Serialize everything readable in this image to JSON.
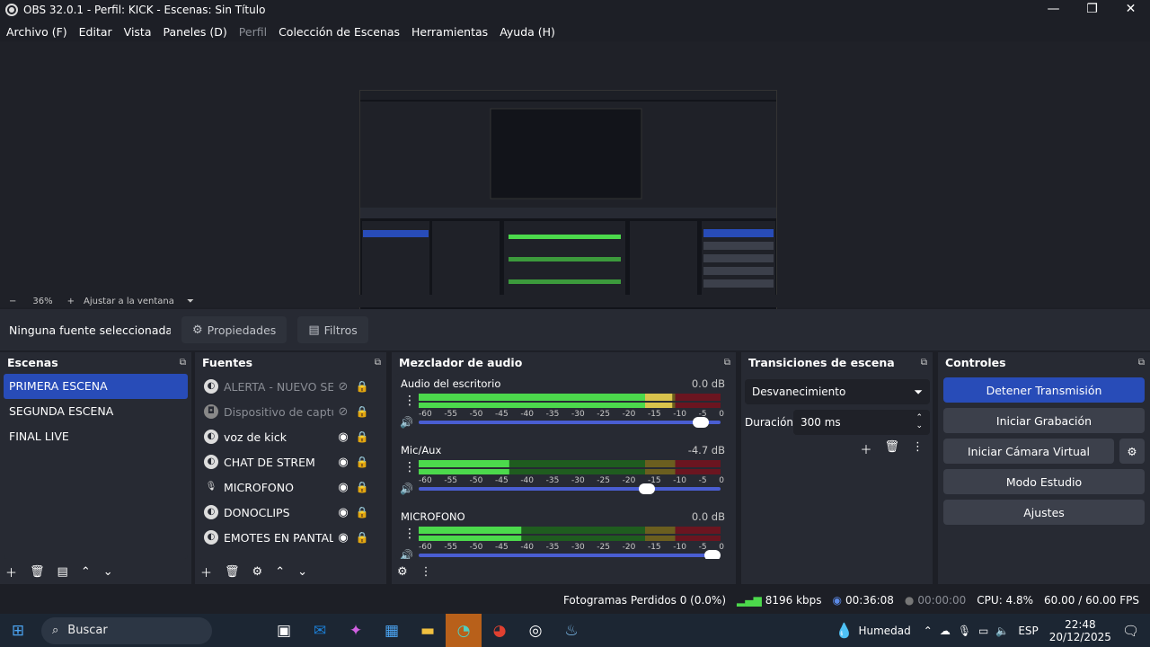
{
  "window": {
    "title": "OBS 32.0.1 - Perfil: KICK - Escenas: Sin Título",
    "minimize": "—",
    "maximize": "❐",
    "close": "✕"
  },
  "menu": [
    {
      "label": "Archivo (F)",
      "enabled": true
    },
    {
      "label": "Editar",
      "enabled": true
    },
    {
      "label": "Vista",
      "enabled": true
    },
    {
      "label": "Paneles (D)",
      "enabled": true
    },
    {
      "label": "Perfil",
      "enabled": false
    },
    {
      "label": "Colección de Escenas",
      "enabled": true
    },
    {
      "label": "Herramientas",
      "enabled": true
    },
    {
      "label": "Ayuda (H)",
      "enabled": true
    }
  ],
  "zoom": {
    "minus": "−",
    "value": "36%",
    "plus": "+",
    "fit": "Ajustar a la ventana",
    "dropdown": "⏷"
  },
  "source_bar": {
    "no_source": "Ninguna fuente seleccionada",
    "properties": "Propiedades",
    "filters": "Filtros"
  },
  "scenes": {
    "title": "Escenas",
    "items": [
      {
        "label": "PRIMERA ESCENA",
        "selected": true
      },
      {
        "label": "SEGUNDA ESCENA",
        "selected": false
      },
      {
        "label": "FINAL LIVE",
        "selected": false
      }
    ]
  },
  "sources": {
    "title": "Fuentes",
    "items": [
      {
        "label": "ALERTA - NUEVO SEG",
        "visible": false,
        "icon": "browser-icon"
      },
      {
        "label": "Dispositivo de captura",
        "visible": false,
        "icon": "camera-icon"
      },
      {
        "label": "voz de kick",
        "visible": true,
        "icon": "browser-icon"
      },
      {
        "label": "CHAT DE STREM",
        "visible": true,
        "icon": "browser-icon"
      },
      {
        "label": "MICROFONO",
        "visible": true,
        "icon": "microphone-icon"
      },
      {
        "label": "DONOCLIPS",
        "visible": true,
        "icon": "browser-icon"
      },
      {
        "label": "EMOTES EN PANTALLA",
        "visible": true,
        "icon": "browser-icon"
      }
    ]
  },
  "mixer": {
    "title": "Mezclador de audio",
    "ticks": [
      "-60",
      "-55",
      "-50",
      "-45",
      "-40",
      "-35",
      "-30",
      "-25",
      "-20",
      "-15",
      "-10",
      "-5",
      "0"
    ],
    "channels": [
      {
        "name": "Audio del escritorio",
        "db": "0.0 dB",
        "level": 0.84,
        "fader": 0.96
      },
      {
        "name": "Mic/Aux",
        "db": "-4.7 dB",
        "level": 0.3,
        "fader": 0.77
      },
      {
        "name": "MICROFONO",
        "db": "0.0 dB",
        "level": 0.34,
        "fader": 1.0
      }
    ]
  },
  "transitions": {
    "title": "Transiciones de escena",
    "type": "Desvanecimiento",
    "duration_label": "Duración",
    "duration_value": "300 ms"
  },
  "controls": {
    "title": "Controles",
    "buttons": [
      {
        "label": "Detener Transmisión",
        "active": true
      },
      {
        "label": "Iniciar Grabación",
        "active": false
      },
      {
        "label": "Iniciar Cámara Virtual",
        "active": false
      },
      {
        "label": "Modo Estudio",
        "active": false
      },
      {
        "label": "Ajustes",
        "active": false
      }
    ]
  },
  "status": {
    "dropped": "Fotogramas Perdidos 0 (0.0%)",
    "bitrate": "8196 kbps",
    "stream_time": "00:36:08",
    "rec_time": "00:00:00",
    "cpu": "CPU: 4.8%",
    "fps": "60.00 / 60.00 FPS"
  },
  "taskbar": {
    "search": "Buscar",
    "weather": "Humedad",
    "lang": "ESP",
    "time": "22:48",
    "date": "20/12/2025"
  },
  "colors": {
    "accent": "#284cb8",
    "meter_green": "#4cd94c",
    "meter_yellow": "#d9c34c",
    "meter_red": "#b81f2e"
  }
}
